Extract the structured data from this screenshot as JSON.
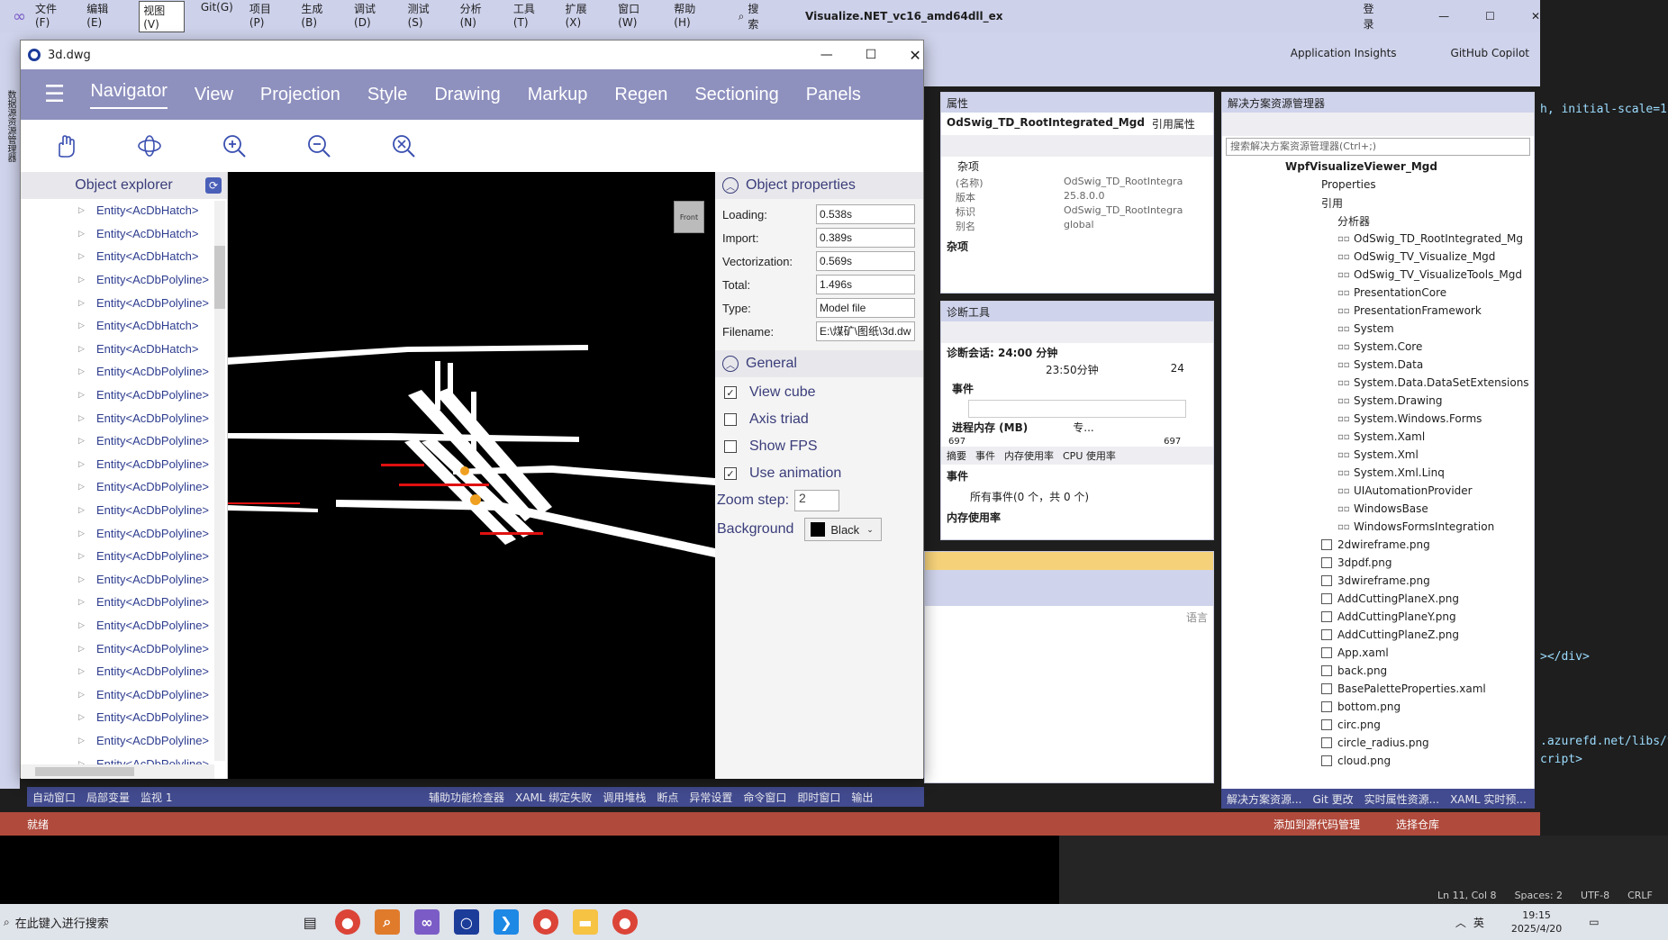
{
  "vs": {
    "menu": [
      "文件(F)",
      "编辑(E)",
      "视图(V)",
      "Git(G)",
      "项目(P)",
      "生成(B)",
      "调试(D)",
      "测试(S)",
      "分析(N)",
      "工具(T)",
      "扩展(X)",
      "窗口(W)",
      "帮助(H)"
    ],
    "search": "搜索",
    "solution_title": "Visualize.NET_vc16_amd64dll_ex",
    "login": "登录",
    "app_insights": "Application Insights",
    "copilot": "GitHub Copilot",
    "side_tab": "数据源资源管理器"
  },
  "properties": {
    "header": "属性",
    "object": "OdSwig_TD_RootIntegrated_Mgd",
    "object_type": "引用属性",
    "category": "杂项",
    "rows": [
      {
        "k": "(名称)",
        "v": "OdSwig_TD_RootIntegra"
      },
      {
        "k": "版本",
        "v": "25.8.0.0"
      },
      {
        "k": "标识",
        "v": "OdSwig_TD_RootIntegra"
      },
      {
        "k": "别名",
        "v": "global"
      }
    ],
    "footer": "杂项"
  },
  "diag": {
    "header": "诊断工具",
    "session": "诊断会话: 24:00 分钟",
    "time_label": "23:50分钟",
    "time_label2": "24",
    "events": "事件",
    "memory": "进程内存 (MB)",
    "legend": "专...",
    "mem_left": "697",
    "mem_right": "697",
    "tabs": [
      "摘要",
      "事件",
      "内存使用率",
      "CPU 使用率"
    ],
    "events_hdr": "事件",
    "all_events": "所有事件(0 个，共 0 个)",
    "mem_usage": "内存使用率"
  },
  "output": {
    "lang_hint": "语言"
  },
  "solution_explorer": {
    "header": "解决方案资源管理器",
    "search_placeholder": "搜索解决方案资源管理器(Ctrl+;)",
    "project": "WpfVisualizeViewer_Mgd",
    "properties": "Properties",
    "refs": "引用",
    "analyzer": "分析器",
    "references": [
      "OdSwig_TD_RootIntegrated_Mg",
      "OdSwig_TV_Visualize_Mgd",
      "OdSwig_TV_VisualizeTools_Mgd",
      "PresentationCore",
      "PresentationFramework",
      "System",
      "System.Core",
      "System.Data",
      "System.Data.DataSetExtensions",
      "System.Drawing",
      "System.Windows.Forms",
      "System.Xaml",
      "System.Xml",
      "System.Xml.Linq",
      "UIAutomationProvider",
      "WindowsBase",
      "WindowsFormsIntegration"
    ],
    "files": [
      "2dwireframe.png",
      "3dpdf.png",
      "3dwireframe.png",
      "AddCuttingPlaneX.png",
      "AddCuttingPlaneY.png",
      "AddCuttingPlaneZ.png",
      "App.xaml",
      "back.png",
      "BasePaletteProperties.xaml",
      "bottom.png",
      "circ.png",
      "circle_radius.png",
      "cloud.png"
    ],
    "bottom_tabs": [
      "解决方案资源...",
      "Git 更改",
      "实时属性资源...",
      "XAML 实时预..."
    ]
  },
  "bottom_tabs_left": [
    "自动窗口",
    "局部变量",
    "监视 1"
  ],
  "bottom_tabs_mid": [
    "辅助功能检查器",
    "XAML 绑定失败",
    "调用堆栈",
    "断点",
    "异常设置",
    "命令窗口",
    "即时窗口",
    "输出"
  ],
  "status": {
    "ready": "就绪",
    "source": "添加到源代码管理",
    "repo": "选择仓库"
  },
  "editor_status": {
    "pos": "Ln 11, Col 8",
    "spaces": "Spaces: 2",
    "enc": "UTF-8",
    "eol": "CRLF"
  },
  "code": {
    "line1": "h, initial-scale=1'",
    "line2": "></div>",
    "line3": ".azurefd.net/libs/v",
    "line4": "cript>"
  },
  "viewer": {
    "title": "3d.dwg",
    "tabs": [
      "Navigator",
      "View",
      "Projection",
      "Style",
      "Drawing",
      "Markup",
      "Regen",
      "Sectioning",
      "Panels"
    ],
    "object_explorer": "Object explorer",
    "items": [
      "Entity<AcDbHatch>",
      "Entity<AcDbHatch>",
      "Entity<AcDbHatch>",
      "Entity<AcDbPolyline>",
      "Entity<AcDbPolyline>",
      "Entity<AcDbHatch>",
      "Entity<AcDbHatch>",
      "Entity<AcDbPolyline>",
      "Entity<AcDbPolyline>",
      "Entity<AcDbPolyline>",
      "Entity<AcDbPolyline>",
      "Entity<AcDbPolyline>",
      "Entity<AcDbPolyline>",
      "Entity<AcDbPolyline>",
      "Entity<AcDbPolyline>",
      "Entity<AcDbPolyline>",
      "Entity<AcDbPolyline>",
      "Entity<AcDbPolyline>",
      "Entity<AcDbPolyline>",
      "Entity<AcDbPolyline>",
      "Entity<AcDbPolyline>",
      "Entity<AcDbPolyline>",
      "Entity<AcDbPolyline>",
      "Entity<AcDbPolyline>",
      "Entity<AcDbPolyline>"
    ],
    "viewcube": "Front",
    "object_properties": "Object properties",
    "props": [
      {
        "k": "Loading:",
        "v": "0.538s"
      },
      {
        "k": "Import:",
        "v": "0.389s"
      },
      {
        "k": "Vectorization:",
        "v": "0.569s"
      },
      {
        "k": "Total:",
        "v": "1.496s"
      },
      {
        "k": "Type:",
        "v": "Model file"
      },
      {
        "k": "Filename:",
        "v": "E:\\煤矿\\图纸\\3d.dw"
      }
    ],
    "general": "General",
    "checks": [
      {
        "label": "View cube",
        "checked": true
      },
      {
        "label": "Axis triad",
        "checked": false
      },
      {
        "label": "Show FPS",
        "checked": false
      },
      {
        "label": "Use animation",
        "checked": true
      }
    ],
    "zoom_step_label": "Zoom step:",
    "zoom_step": "2",
    "background_label": "Background",
    "background": "Black"
  },
  "taskbar": {
    "search": "在此键入进行搜索",
    "time": "19:15",
    "date": "2025/4/20",
    "ime": "英"
  }
}
